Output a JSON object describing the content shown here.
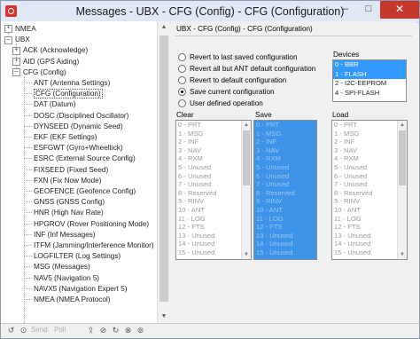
{
  "window": {
    "title": "Messages - UBX - CFG (Config) - CFG (Configuration)",
    "buttons": [
      "–",
      "□",
      "✕"
    ],
    "accent_color": "#d8342b"
  },
  "tree": {
    "items": [
      {
        "label": "NMEA",
        "toggle": "+"
      },
      {
        "label": "UBX",
        "toggle": "–"
      },
      {
        "label": "ACK (Acknowledge)",
        "toggle": "+"
      },
      {
        "label": "AID (GPS Aiding)",
        "toggle": "+"
      },
      {
        "label": "CFG (Config)",
        "toggle": "–"
      },
      {
        "label": "ANT (Antenna Settings)"
      },
      {
        "label": "CFG (Configuration)",
        "selected": true
      },
      {
        "label": "DAT (Datum)"
      },
      {
        "label": "DOSC (Disciplined Oscillator)"
      },
      {
        "label": "DYNSEED (Dynamic Seed)"
      },
      {
        "label": "EKF (EKF Settings)"
      },
      {
        "label": "ESFGWT (Gyro+Wheeltick)"
      },
      {
        "label": "ESRC (External Source Config)"
      },
      {
        "label": "FIXSEED (Fixed Seed)"
      },
      {
        "label": "FXN (Fix Now Mode)"
      },
      {
        "label": "GEOFENCE (Geofence Config)"
      },
      {
        "label": "GNSS (GNSS Config)"
      },
      {
        "label": "HNR (High Nav Rate)"
      },
      {
        "label": "HPGROV (Rover Positioning Mode)"
      },
      {
        "label": "INF (Inf Messages)"
      },
      {
        "label": "ITFM (Jamming/Interference Monitor)"
      },
      {
        "label": "LOGFILTER (Log Settings)"
      },
      {
        "label": "MSG (Messages)"
      },
      {
        "label": "NAV5 (Navigation 5)"
      },
      {
        "label": "NAVX5 (Navigation Expert 5)"
      },
      {
        "label": "NMEA (NMEA Protocol)"
      }
    ]
  },
  "panel": {
    "header": "UBX - CFG (Config) - CFG (Configuration)",
    "options": [
      {
        "label": "Revert to last saved configuration",
        "checked": false
      },
      {
        "label": "Revert all but ANT default configuration",
        "checked": false
      },
      {
        "label": "Revert to default configuration",
        "checked": false
      },
      {
        "label": "Save current configuration",
        "checked": true
      },
      {
        "label": "User defined operation",
        "checked": false
      }
    ],
    "devices": {
      "label": "Devices",
      "items": [
        "0 - BBR",
        "1 - FLASH",
        "2 - I2C-EEPROM",
        "4 - SPI-FLASH"
      ],
      "selected": [
        0,
        1
      ]
    },
    "clear": {
      "label": "Clear"
    },
    "save": {
      "label": "Save"
    },
    "load": {
      "label": "Load"
    },
    "sections": [
      "0 - PRT",
      "1 - MSG",
      "2 - INF",
      "3 - NAV",
      "4 - RXM",
      "5 - Unused",
      "6 - Unused",
      "7 - Unused",
      "8 - Reserved",
      "9 - RINV",
      "10 - ANT",
      "11 - LOG",
      "12 - FTS",
      "13 - Unused",
      "14 - Unused",
      "15 - Unused"
    ]
  },
  "statusbar": {
    "items": [
      "Send",
      "Poll"
    ]
  }
}
